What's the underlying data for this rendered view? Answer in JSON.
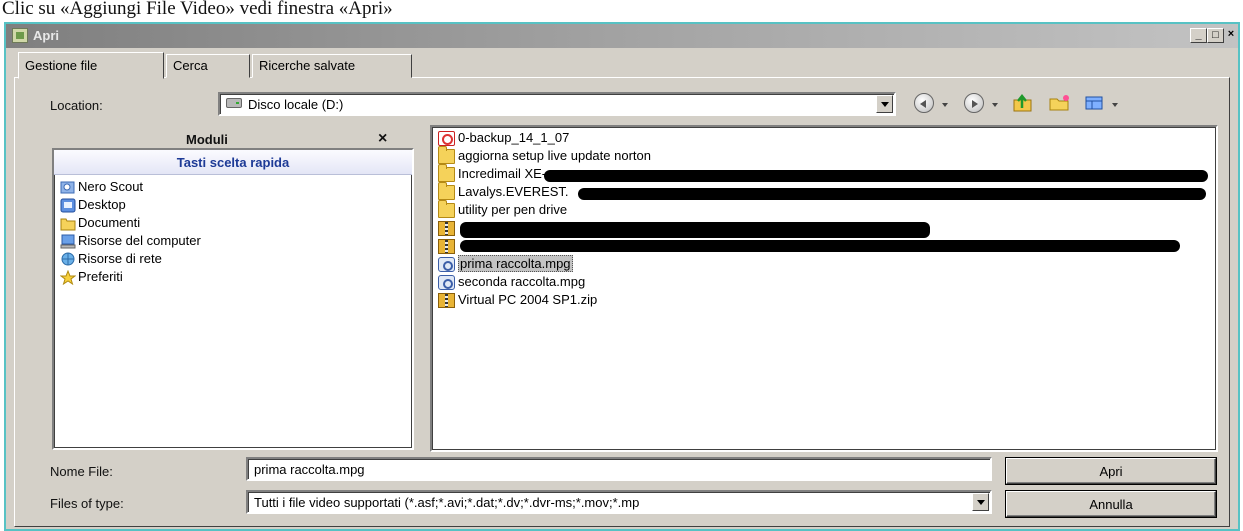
{
  "caption": "Clic su «Aggiungi File Video» vedi finestra «Apri»",
  "dialog": {
    "title": "Apri",
    "controls": {
      "minimize": "_",
      "maximize": "□",
      "close": "×"
    }
  },
  "tabs": [
    {
      "label": "Gestione file",
      "active": true
    },
    {
      "label": "Cerca",
      "active": false
    },
    {
      "label": "Ricerche salvate",
      "active": false
    }
  ],
  "location": {
    "label": "Location:",
    "value": "Disco locale (D:)",
    "icon": "drive-icon"
  },
  "toolbar": [
    {
      "name": "back-icon"
    },
    {
      "name": "forward-icon"
    },
    {
      "name": "up-folder-icon"
    },
    {
      "name": "new-folder-icon"
    },
    {
      "name": "view-menu-icon"
    }
  ],
  "modules": {
    "title": "Moduli",
    "close": "×",
    "section_title": "Tasti scelta rapida",
    "items": [
      {
        "label": "Nero Scout",
        "icon": "nero-scout-icon"
      },
      {
        "label": "Desktop",
        "icon": "desktop-icon"
      },
      {
        "label": "Documenti",
        "icon": "documents-icon"
      },
      {
        "label": "Risorse del computer",
        "icon": "computer-icon"
      },
      {
        "label": "Risorse di rete",
        "icon": "network-icon"
      },
      {
        "label": "Preferiti",
        "icon": "favorites-star-icon"
      }
    ]
  },
  "files": [
    {
      "label": "0-backup_14_1_07",
      "icon": "backup-icon",
      "selected": false
    },
    {
      "label": "aggiorna setup live update norton",
      "icon": "folder-icon",
      "selected": false
    },
    {
      "label": "Incredimail XE-",
      "icon": "folder-icon",
      "selected": false
    },
    {
      "label": "Lavalys.EVEREST.",
      "icon": "folder-icon",
      "selected": false
    },
    {
      "label": "utility per pen drive",
      "icon": "folder-icon",
      "selected": false
    },
    {
      "label": "",
      "icon": "archive-icon",
      "selected": false
    },
    {
      "label": "",
      "icon": "archive-icon",
      "selected": false
    },
    {
      "label": "prima raccolta.mpg",
      "icon": "media-file-icon",
      "selected": true
    },
    {
      "label": "seconda raccolta.mpg",
      "icon": "media-file-icon",
      "selected": false
    },
    {
      "label": "Virtual PC 2004 SP1.zip",
      "icon": "zip-archive-icon",
      "selected": false
    }
  ],
  "filename": {
    "label": "Nome File:",
    "value": "prima raccolta.mpg"
  },
  "filetype": {
    "label": "Files of type:",
    "value": "Tutti i file video supportati (*.asf;*.avi;*.dat;*.dv;*.dvr-ms;*.mov;*.mp"
  },
  "buttons": {
    "open": "Apri",
    "cancel": "Annulla"
  },
  "colors": {
    "dialog_border": "#57c2c4",
    "face": "#d4d0c8",
    "section_title": "#1d3a96"
  }
}
